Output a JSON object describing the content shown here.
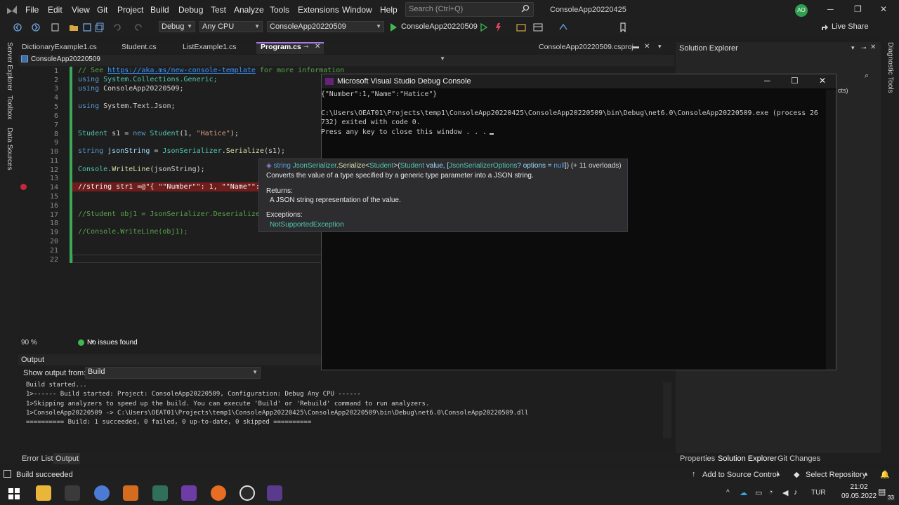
{
  "menu": [
    "File",
    "Edit",
    "View",
    "Git",
    "Project",
    "Build",
    "Debug",
    "Test",
    "Analyze",
    "Tools",
    "Extensions",
    "Window",
    "Help"
  ],
  "search": {
    "placeholder": "Search (Ctrl+Q)"
  },
  "window": {
    "title": "ConsoleApp20220425",
    "avatar": "AO"
  },
  "toolbar": {
    "config": "Debug",
    "platform": "Any CPU",
    "project": "ConsoleApp20220509",
    "run_label": "ConsoleApp20220509",
    "live_share": "Live Share"
  },
  "left_tabs": [
    "Server Explorer",
    "Toolbox",
    "Data Sources"
  ],
  "right_tabs": [
    "Diagnostic Tools"
  ],
  "doc_tabs": [
    "DictionaryExample1.cs",
    "Student.cs",
    "ListExample1.cs",
    "Program.cs",
    "ConsoleApp20220509.csproj"
  ],
  "nav": {
    "project": "ConsoleApp20220509"
  },
  "editor": {
    "line_numbers": [
      "1",
      "2",
      "3",
      "4",
      "5",
      "6",
      "7",
      "8",
      "9",
      "10",
      "11",
      "12",
      "13",
      "14",
      "15",
      "16",
      "17",
      "18",
      "19",
      "20",
      "21",
      "22"
    ],
    "line1_comment": "// See ",
    "line1_link": "https://aka.ms/new-console-template",
    "line1_rest": " for more information",
    "line2_kw": "using",
    "line2_rest": " System.Collections.Generic;",
    "line3_kw": "using",
    "line3_rest": " ConsoleApp20220509;",
    "line5_kw": "using",
    "line5_rest": " System.Text.Json;",
    "line8_type": "Student",
    "line8_a": " s1 = ",
    "line8_new": "new",
    "line8_type2": "Student",
    "line8_b": "(1, ",
    "line8_str": "\"Hatice\"",
    "line8_c": ");",
    "line10_kw": "string",
    "line10_var": " jsonString",
    "line10_a": " = ",
    "line10_type": "JsonSerializer",
    "line10_b": ".",
    "line10_fn": "Serialize",
    "line10_c": "(s1);",
    "line12_type": "Console",
    "line12_a": ".",
    "line12_fn": "WriteLine",
    "line12_b": "(jsonString);",
    "line14": "//string str1 =@\"{ \"\"Number\"\": 1, \"\"Name\"\": \"",
    "line17": "//Student obj1 = JsonSerializer.Deserialize<S",
    "line19": "//Console.WriteLine(obj1);"
  },
  "editor_status": {
    "zoom": "90 %",
    "issues": "No issues found"
  },
  "tooltip": {
    "sig_kw": "string",
    "sig_cls": "JsonSerializer",
    "sig_fn": ".Serialize",
    "sig_lt": "<",
    "sig_t1": "Student",
    "sig_rest1": ">(",
    "sig_t2": "Student",
    "sig_p1": " value, [",
    "sig_t3": "JsonSerializerOptions",
    "sig_p2": "? options = ",
    "sig_null": "null",
    "sig_end": "])",
    "overloads": "(+ 11 overloads)",
    "summary": "Converts the value of a type specified by a generic type parameter into a JSON string.",
    "returns_label": "Returns:",
    "returns_text": "A JSON string representation of the value.",
    "exceptions_label": "Exceptions:",
    "exception": "NotSupportedException"
  },
  "console": {
    "title": "Microsoft Visual Studio Debug Console",
    "lines": [
      "{\"Number\":1,\"Name\":\"Hatice\"}",
      "",
      "C:\\Users\\OEAT01\\Projects\\temp1\\ConsoleApp20220425\\ConsoleApp20220509\\bin\\Debug\\net6.0\\ConsoleApp20220509.exe (process 26",
      "732) exited with code 0.",
      "Press any key to close this window . . ."
    ]
  },
  "output": {
    "header": "Output",
    "show_from_label": "Show output from:",
    "source": "Build",
    "lines": [
      "Build started...",
      "1>------ Build started: Project: ConsoleApp20220509, Configuration: Debug Any CPU ------",
      "1>Skipping analyzers to speed up the build. You can execute 'Build' or 'Rebuild' command to run analyzers.",
      "1>ConsoleApp20220509 -> C:\\Users\\OEAT01\\Projects\\temp1\\ConsoleApp20220425\\ConsoleApp20220509\\bin\\Debug\\net6.0\\ConsoleApp20220509.dll",
      "========== Build: 1 succeeded, 0 failed, 0 up-to-date, 0 skipped =========="
    ]
  },
  "bottom_tabs": [
    "Error List",
    "Output"
  ],
  "solution": {
    "title": "Solution Explorer",
    "partial": "cts)",
    "tabs": [
      "Properties",
      "Solution Explorer",
      "Git Changes"
    ]
  },
  "statusbar": {
    "message": "Build succeeded",
    "source_control": "Add to Source Control",
    "repository": "Select Repository"
  },
  "taskbar": {
    "lang": "TUR",
    "time": "21:02",
    "date": "09.05.2022",
    "notifications": "33"
  },
  "colors": {
    "accent": "#a979e8",
    "run_green": "#3fb950",
    "breakpoint": "#c5283d",
    "change_bar": "#3ea85a"
  }
}
